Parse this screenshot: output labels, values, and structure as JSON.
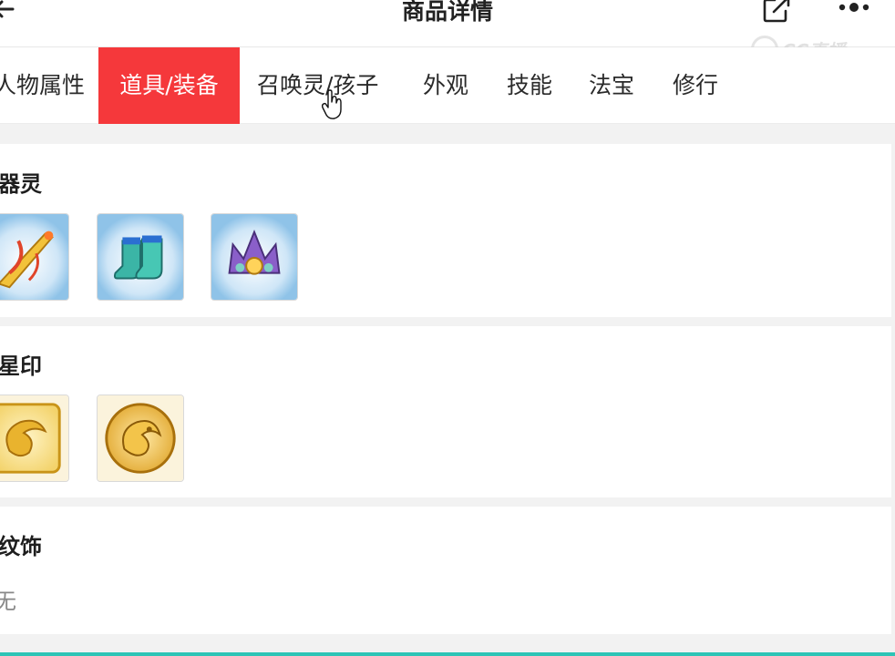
{
  "header": {
    "title": "商品详情",
    "watermark": "CC直播"
  },
  "tabs": [
    {
      "label": "人物属性",
      "active": false
    },
    {
      "label": "道具/装备",
      "active": true
    },
    {
      "label": "召唤灵/孩子",
      "active": false
    },
    {
      "label": "外观",
      "active": false
    },
    {
      "label": "技能",
      "active": false
    },
    {
      "label": "法宝",
      "active": false
    },
    {
      "label": "修行",
      "active": false
    }
  ],
  "sections": [
    {
      "title": "器灵",
      "items": [
        "weapon-spirit-icon",
        "boots-spirit-icon",
        "crown-spirit-icon"
      ]
    },
    {
      "title": "星印",
      "items": [
        "gold-dragon-seal-icon",
        "gold-tiger-seal-icon"
      ]
    },
    {
      "title": "纹饰",
      "empty_text": "无"
    }
  ],
  "colors": {
    "accent": "#f5383b",
    "background": "#f2f2f2",
    "card_border": "#d9d9d9",
    "bottom_strip": "#2ec4b6"
  }
}
